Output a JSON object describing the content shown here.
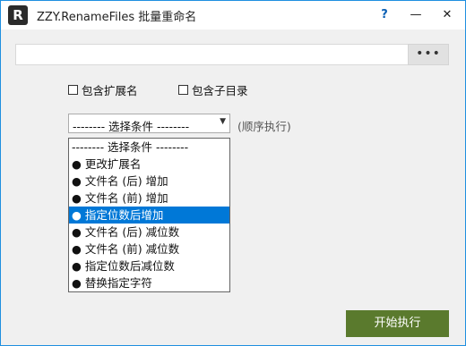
{
  "window": {
    "title": "ZZY.RenameFiles 批量重命名",
    "icon_letter": "R",
    "help_label": "?",
    "minimize_label": "—",
    "close_label": "✕"
  },
  "path": {
    "value": "",
    "placeholder": "",
    "browse_label": "•••"
  },
  "options": {
    "include_extension": {
      "label": "包含扩展名",
      "checked": false
    },
    "include_subdirs": {
      "label": "包含子目录",
      "checked": false
    }
  },
  "condition_select": {
    "selected": "-------- 选择条件 --------",
    "hint": "(顺序执行)",
    "highlighted_index": 4,
    "items": [
      "-------- 选择条件 --------",
      "● 更改扩展名",
      "● 文件名 (后) 增加",
      "● 文件名 (前) 增加",
      "● 指定位数后增加",
      "● 文件名 (后) 减位数",
      "● 文件名 (前) 减位数",
      "● 指定位数后减位数",
      "● 替换指定字符"
    ]
  },
  "actions": {
    "start_label": "开始执行"
  },
  "colors": {
    "accent": "#0078d7",
    "start_button": "#5a7a2d",
    "window_border": "#1f8fe0"
  }
}
